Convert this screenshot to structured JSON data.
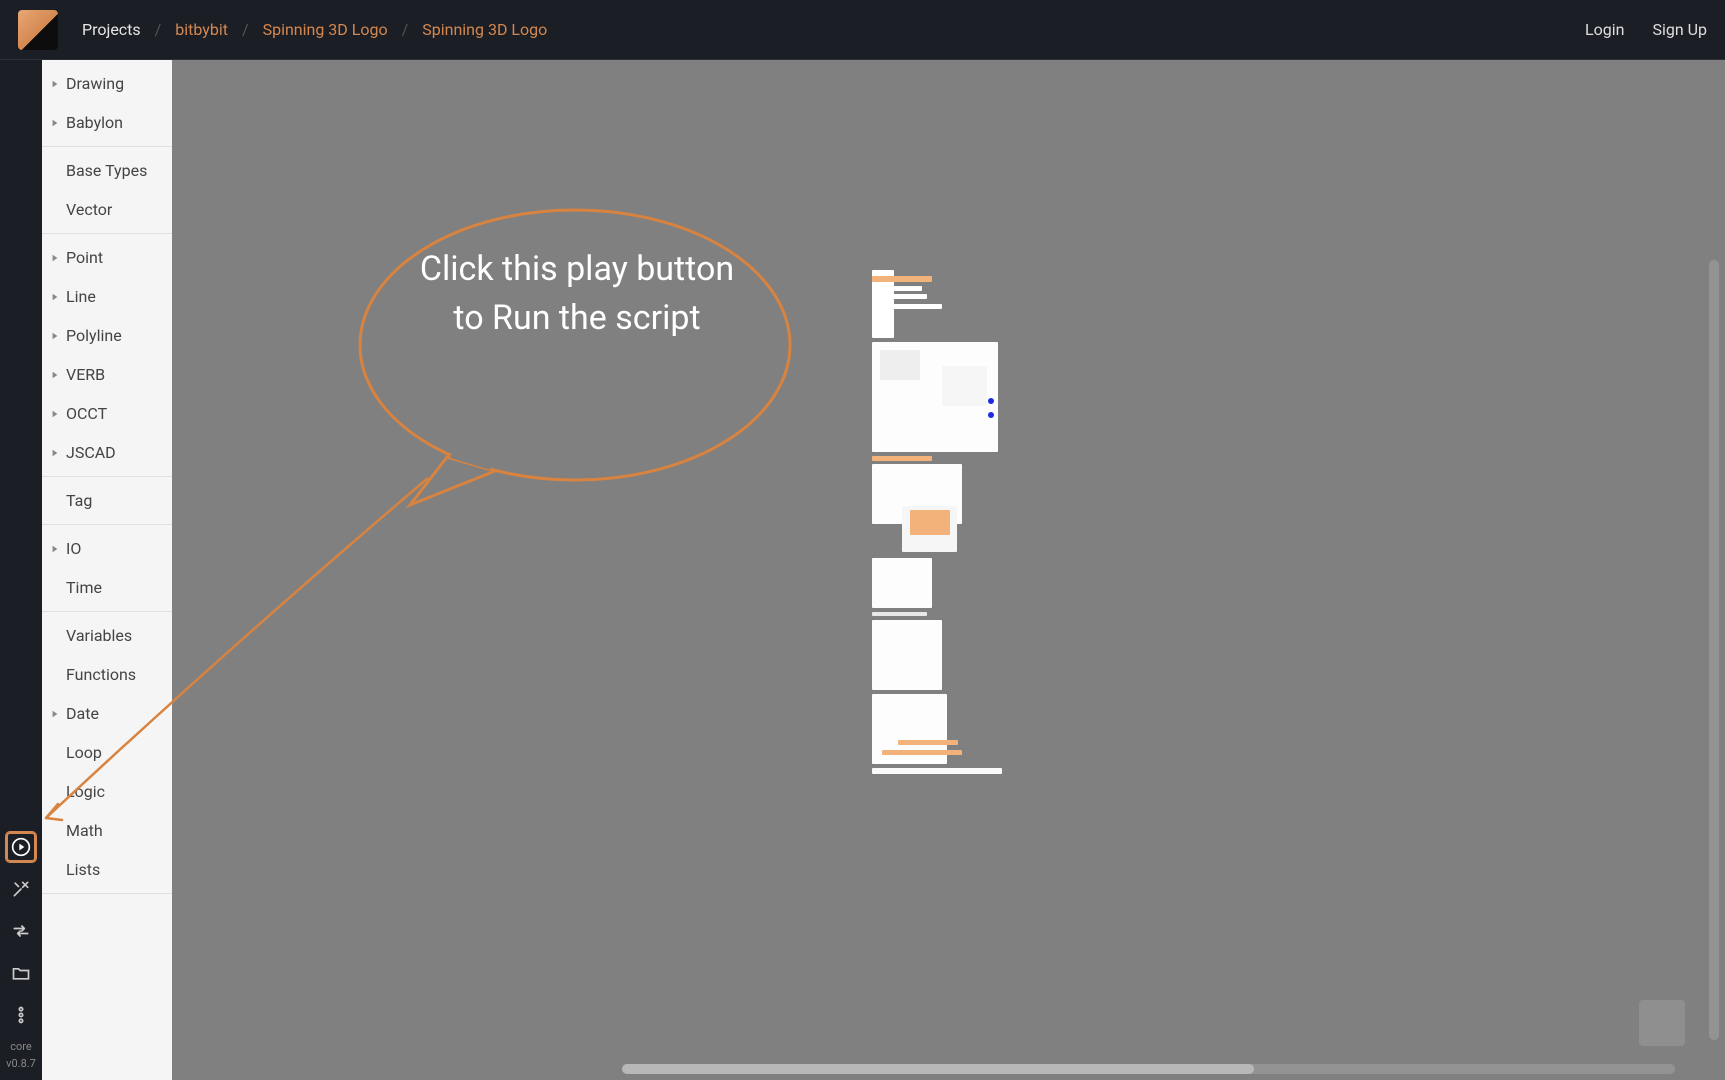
{
  "header": {
    "projects_label": "Projects",
    "breadcrumb": [
      {
        "label": "bitbybit",
        "kind": "link"
      },
      {
        "label": "Spinning 3D Logo",
        "kind": "link"
      },
      {
        "label": "Spinning 3D Logo",
        "kind": "link"
      }
    ],
    "login": "Login",
    "signup": "Sign Up"
  },
  "rail": {
    "core_label": "core",
    "version_label": "v0.8.7"
  },
  "sidepanel": {
    "groups": [
      [
        {
          "label": "Drawing",
          "expandable": true
        },
        {
          "label": "Babylon",
          "expandable": true
        }
      ],
      [
        {
          "label": "Base Types",
          "expandable": false
        },
        {
          "label": "Vector",
          "expandable": false
        }
      ],
      [
        {
          "label": "Point",
          "expandable": true
        },
        {
          "label": "Line",
          "expandable": true
        },
        {
          "label": "Polyline",
          "expandable": true
        },
        {
          "label": "VERB",
          "expandable": true
        },
        {
          "label": "OCCT",
          "expandable": true
        },
        {
          "label": "JSCAD",
          "expandable": true
        }
      ],
      [
        {
          "label": "Tag",
          "expandable": false
        }
      ],
      [
        {
          "label": "IO",
          "expandable": true
        },
        {
          "label": "Time",
          "expandable": false
        }
      ],
      [
        {
          "label": "Variables",
          "expandable": false
        },
        {
          "label": "Functions",
          "expandable": false
        },
        {
          "label": "Date",
          "expandable": true
        },
        {
          "label": "Loop",
          "expandable": false
        },
        {
          "label": "Logic",
          "expandable": false
        },
        {
          "label": "Math",
          "expandable": false
        },
        {
          "label": "Lists",
          "expandable": false
        }
      ]
    ]
  },
  "annotation": {
    "text": "Click this play button to Run the script"
  }
}
